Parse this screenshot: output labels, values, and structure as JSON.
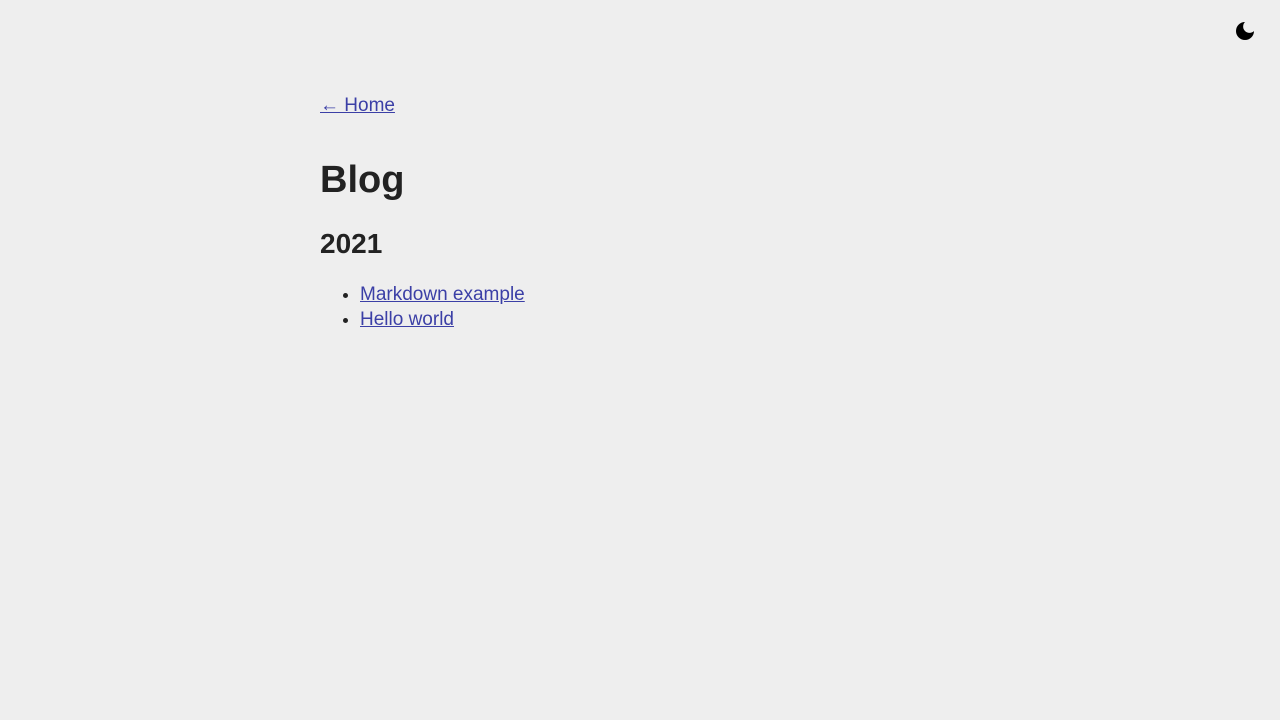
{
  "header": {
    "theme_toggle_icon": "moon-icon",
    "theme_toggle_color": "#000000"
  },
  "nav": {
    "back_label": "← Home"
  },
  "main": {
    "title": "Blog",
    "groups": [
      {
        "year": "2021",
        "posts": [
          {
            "title": "Markdown example"
          },
          {
            "title": "Hello world"
          }
        ]
      }
    ]
  },
  "colors": {
    "background": "#eeeeee",
    "text": "#222222",
    "link": "#3b3fa6"
  }
}
